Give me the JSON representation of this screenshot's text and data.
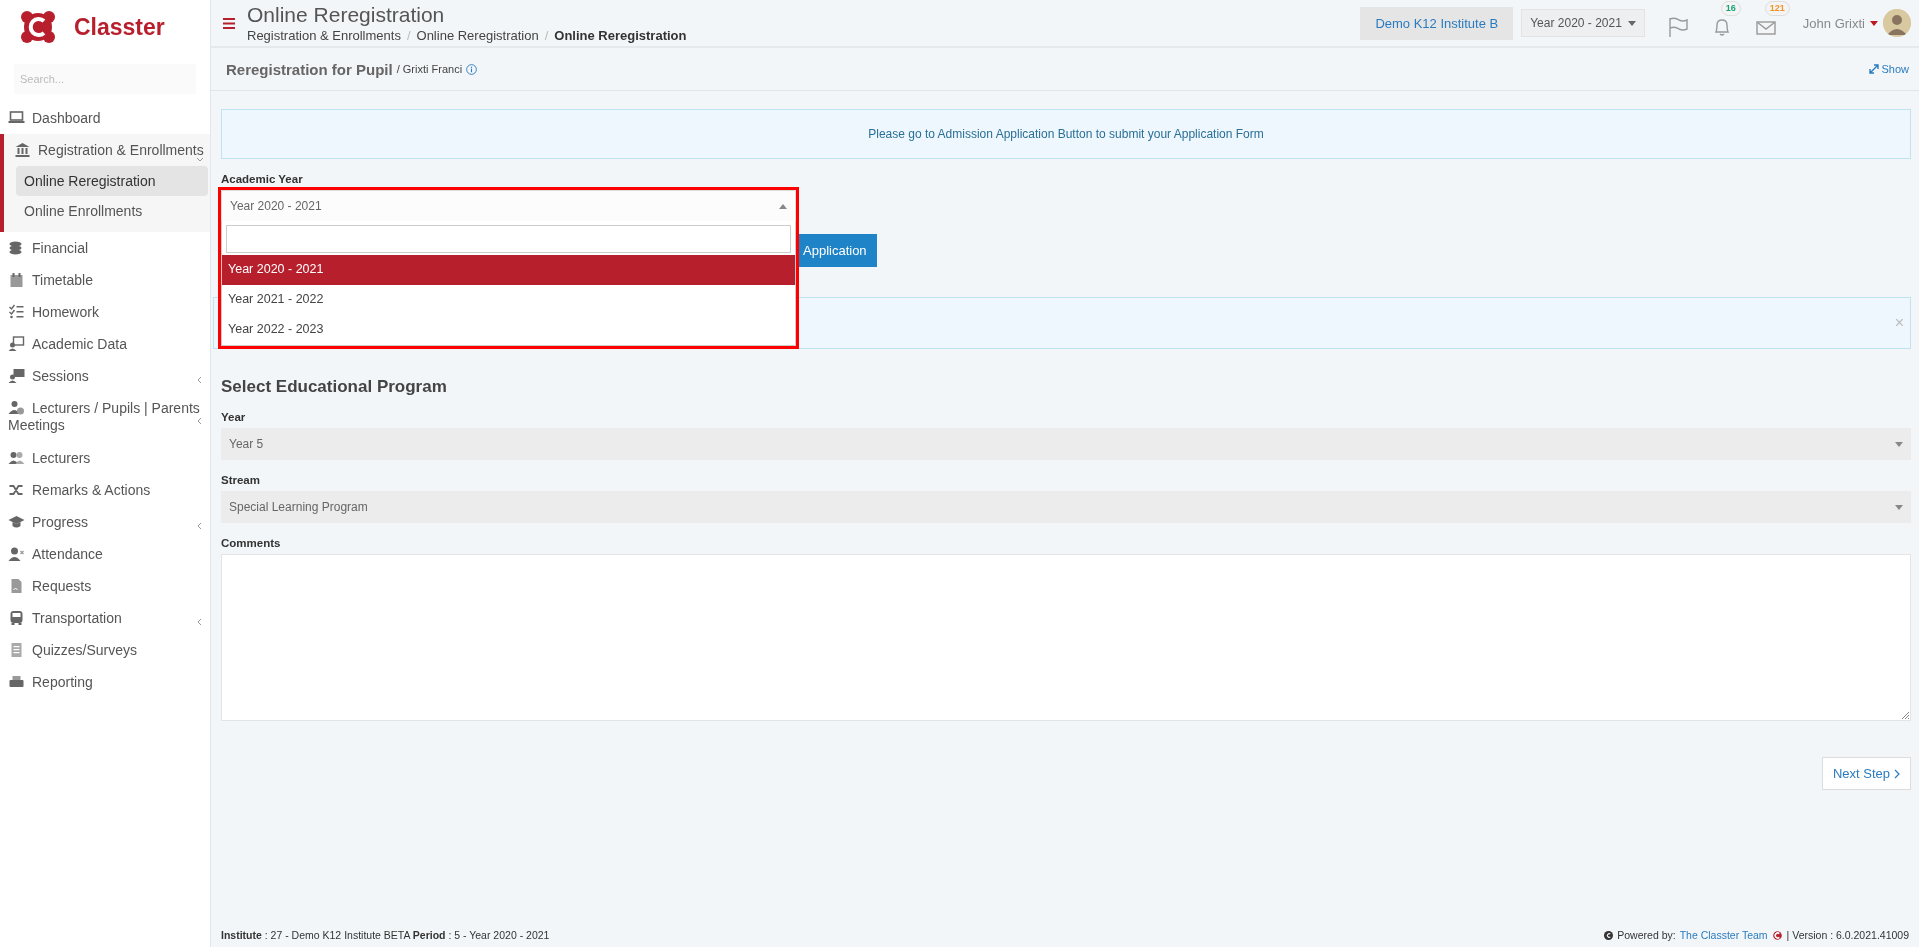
{
  "sidebar": {
    "logo_text": "Classter",
    "search_placeholder": "Search...",
    "items": [
      {
        "label": "Dashboard",
        "selected": false
      },
      {
        "label": "Registration & Enrollments",
        "selected": true,
        "expanded": true,
        "children": [
          {
            "label": "Online Reregistration",
            "selected": true
          },
          {
            "label": "Online Enrollments",
            "selected": false
          }
        ]
      },
      {
        "label": "Financial",
        "selected": false
      },
      {
        "label": "Timetable",
        "selected": false
      },
      {
        "label": "Homework",
        "selected": false
      },
      {
        "label": "Academic Data",
        "selected": false
      },
      {
        "label": "Sessions",
        "selected": false,
        "expanded": false
      },
      {
        "label": "Lecturers / Pupils | Parents Meetings",
        "selected": false,
        "expanded": false
      },
      {
        "label": "Lecturers",
        "selected": false
      },
      {
        "label": "Remarks & Actions",
        "selected": false
      },
      {
        "label": "Progress",
        "selected": false,
        "expanded": false
      },
      {
        "label": "Attendance",
        "selected": false
      },
      {
        "label": "Requests",
        "selected": false
      },
      {
        "label": "Transportation",
        "selected": false,
        "expanded": false
      },
      {
        "label": "Quizzes/Surveys",
        "selected": false
      },
      {
        "label": "Reporting",
        "selected": false
      }
    ]
  },
  "header": {
    "title": "Online Reregistration",
    "breadcrumbs": [
      {
        "label": "Registration & Enrollments",
        "current": false
      },
      {
        "label": "Online Reregistration",
        "current": false
      },
      {
        "label": "Online Reregistration",
        "current": true
      }
    ],
    "separator": "/",
    "institute": "Demo K12 Institute B",
    "year": "Year 2020 - 2021",
    "notifications": [
      {
        "kind": "flag"
      },
      {
        "kind": "bell",
        "count": "16",
        "color": "#1aa37a"
      },
      {
        "kind": "envelope",
        "count": "121",
        "color": "#f0932b"
      }
    ],
    "user": "John Grixti"
  },
  "panel": {
    "title": "Reregistration for Pupil",
    "subtitle": "/ Grixti Franci",
    "show_link": "Show"
  },
  "info_message": "Please go to Admission Application Button to submit your Application Form",
  "academic_year": {
    "label": "Academic Year",
    "value": "Year 2020 - 2021",
    "open": true,
    "options": [
      {
        "label": "Year 2020 - 2021",
        "selected": true
      },
      {
        "label": "Year 2021 - 2022",
        "selected": false
      },
      {
        "label": "Year 2022 - 2023",
        "selected": false
      }
    ],
    "button": "Application"
  },
  "alert_close": "×",
  "program": {
    "heading": "Select Educational Program",
    "fields": [
      {
        "kind": "select",
        "label": "Year",
        "value": "Year 5"
      },
      {
        "kind": "select",
        "label": "Stream",
        "value": "Special Learning Program"
      },
      {
        "kind": "textarea",
        "label": "Comments"
      }
    ],
    "next_button": "Next Step"
  },
  "footer": {
    "info": "**Institute** : 27 - Demo K12 Institute BETA **Period** : 5 - Year 2020 - 2021",
    "powered_label": "Powered by:",
    "powered_link": "The Classter Team",
    "version": "| Version : 6.0.2021.41009"
  }
}
